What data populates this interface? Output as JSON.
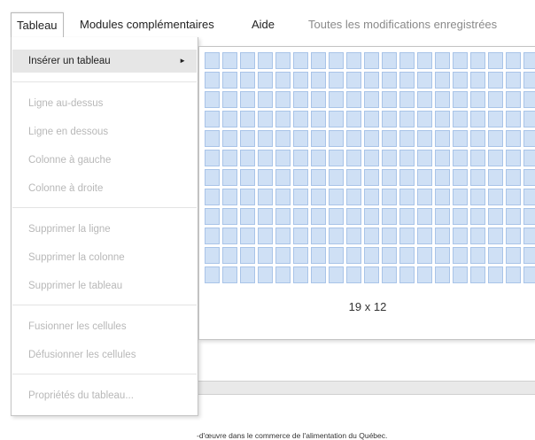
{
  "menubar": {
    "items": [
      "Tableau",
      "Modules complémentaires",
      "Aide"
    ],
    "status": "Toutes les modifications enregistrées"
  },
  "dropdown": {
    "insert_table": "Insérer un tableau",
    "row_below": "Ligne au-dessus",
    "row_under": "Ligne en dessous",
    "col_left": "Colonne à gauche",
    "col_right": "Colonne à droite",
    "delete_row": "Supprimer la ligne",
    "delete_col": "Supprimer la colonne",
    "delete_table": "Supprimer le tableau",
    "merge_cells": "Fusionner les cellules",
    "unmerge_cells": "Défusionner les cellules",
    "table_props": "Propriétés du tableau..."
  },
  "submenu": {
    "columns": 19,
    "rows": 12,
    "size_label": "19 x 12"
  },
  "document": {
    "visible_text": "-d'œuvre dans le commerce de l'alimentation du Québec."
  },
  "colors": {
    "cell_fill": "#cfe0f5",
    "cell_border": "#a9c4e8",
    "highlight": "#e6e6e6",
    "disabled_text": "#b8b8b8"
  },
  "icons": {
    "submenu_arrow": "chevron-right-icon"
  }
}
